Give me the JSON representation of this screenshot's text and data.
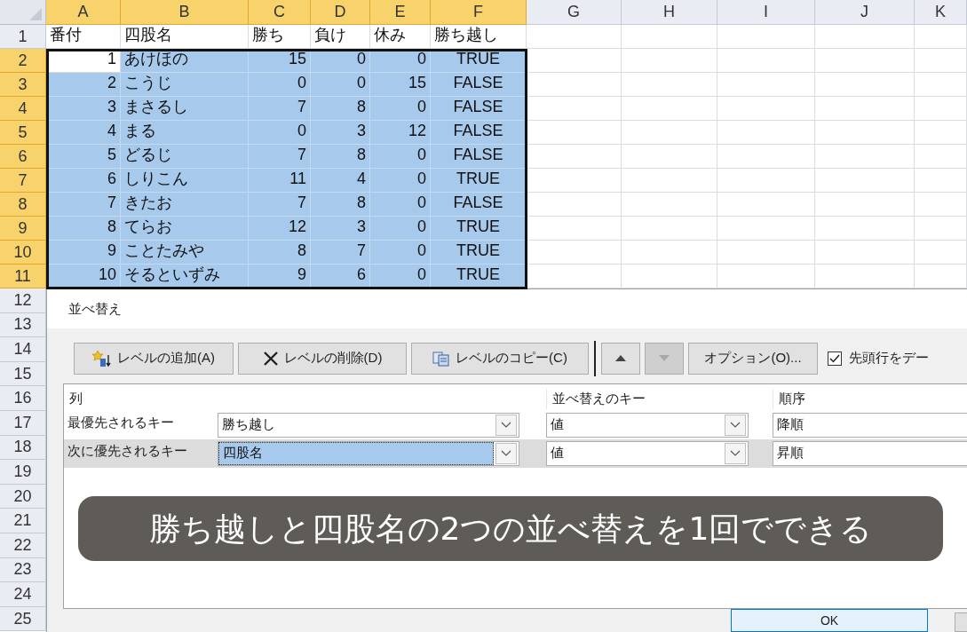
{
  "sheet": {
    "columns": [
      {
        "label": "A",
        "selected": true,
        "kind": "number"
      },
      {
        "label": "B",
        "selected": true,
        "kind": "text"
      },
      {
        "label": "C",
        "selected": true,
        "kind": "number"
      },
      {
        "label": "D",
        "selected": true,
        "kind": "number"
      },
      {
        "label": "E",
        "selected": true,
        "kind": "number"
      },
      {
        "label": "F",
        "selected": true,
        "kind": "boolean"
      },
      {
        "label": "G",
        "selected": false,
        "kind": "text"
      },
      {
        "label": "H",
        "selected": false,
        "kind": "text"
      },
      {
        "label": "I",
        "selected": false,
        "kind": "text"
      },
      {
        "label": "J",
        "selected": false,
        "kind": "text"
      },
      {
        "label": "K",
        "selected": false,
        "kind": "text"
      }
    ],
    "rows": [
      {
        "number": "1",
        "selected": false,
        "active": false,
        "kind": "header",
        "cells": [
          "番付",
          "四股名",
          "勝ち",
          "負け",
          "休み",
          "勝ち越し"
        ]
      },
      {
        "number": "2",
        "selected": true,
        "active": true,
        "kind": "data",
        "cells": [
          "1",
          "あけほの",
          "15",
          "0",
          "0",
          "TRUE"
        ]
      },
      {
        "number": "3",
        "selected": true,
        "active": false,
        "kind": "data",
        "cells": [
          "2",
          "こうじ",
          "0",
          "0",
          "15",
          "FALSE"
        ]
      },
      {
        "number": "4",
        "selected": true,
        "active": false,
        "kind": "data",
        "cells": [
          "3",
          "まさるし",
          "7",
          "8",
          "0",
          "FALSE"
        ]
      },
      {
        "number": "5",
        "selected": true,
        "active": false,
        "kind": "data",
        "cells": [
          "4",
          "まる",
          "0",
          "3",
          "12",
          "FALSE"
        ]
      },
      {
        "number": "6",
        "selected": true,
        "active": false,
        "kind": "data",
        "cells": [
          "5",
          "どるじ",
          "7",
          "8",
          "0",
          "FALSE"
        ]
      },
      {
        "number": "7",
        "selected": true,
        "active": false,
        "kind": "data",
        "cells": [
          "6",
          "しりこん",
          "11",
          "4",
          "0",
          "TRUE"
        ]
      },
      {
        "number": "8",
        "selected": true,
        "active": false,
        "kind": "data",
        "cells": [
          "7",
          "きたお",
          "7",
          "8",
          "0",
          "FALSE"
        ]
      },
      {
        "number": "9",
        "selected": true,
        "active": false,
        "kind": "data",
        "cells": [
          "8",
          "てらお",
          "12",
          "3",
          "0",
          "TRUE"
        ]
      },
      {
        "number": "10",
        "selected": true,
        "active": false,
        "kind": "data",
        "cells": [
          "9",
          "ことたみや",
          "8",
          "7",
          "0",
          "TRUE"
        ]
      },
      {
        "number": "11",
        "selected": true,
        "active": false,
        "kind": "data",
        "cells": [
          "10",
          "そるといずみ",
          "9",
          "6",
          "0",
          "TRUE"
        ]
      }
    ],
    "more_row_numbers": [
      "12",
      "13",
      "14",
      "15",
      "16",
      "17",
      "18",
      "19",
      "20",
      "21",
      "22",
      "23",
      "24",
      "25"
    ]
  },
  "dialog": {
    "title": "並べ替え",
    "toolbar": [
      {
        "kind": "add",
        "label": "レベルの追加(A)",
        "disabled": false
      },
      {
        "kind": "delete",
        "label": "レベルの削除(D)",
        "disabled": false
      },
      {
        "kind": "copy",
        "label": "レベルのコピー(C)",
        "disabled": false
      },
      {
        "kind": "up",
        "disabled": false
      },
      {
        "kind": "down",
        "disabled": true
      },
      {
        "kind": "options",
        "label": "オプション(O)...",
        "disabled": false
      }
    ],
    "header_checkbox": {
      "label": "先頭行をデー",
      "checked": true
    },
    "grid_headers": [
      "列",
      "並べ替えのキー",
      "順序"
    ],
    "levels": [
      {
        "label": "最優先されるキー",
        "column": "勝ち越し",
        "key": "値",
        "order": "降順",
        "selected": false
      },
      {
        "label": "次に優先されるキー",
        "column": "四股名",
        "key": "値",
        "order": "昇順",
        "selected": true
      }
    ],
    "caption": "勝ち越しと四股名の2つの並べ替えを1回でできる",
    "footer_buttons": [
      "OK"
    ]
  }
}
